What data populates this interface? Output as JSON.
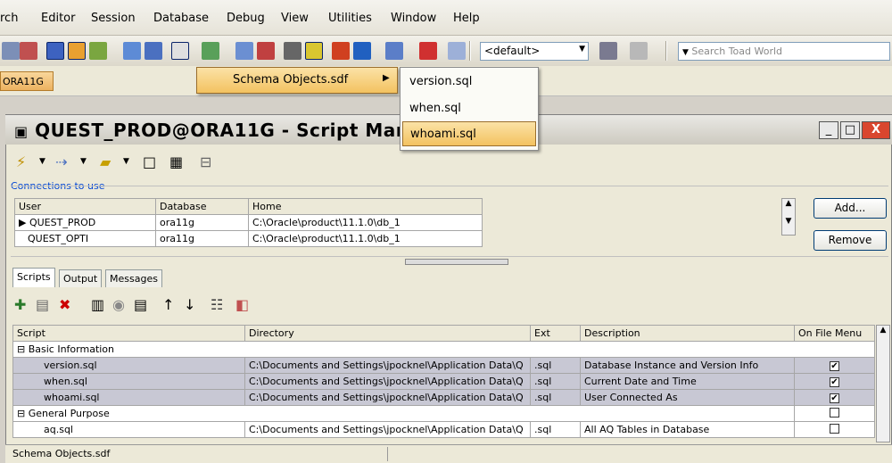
{
  "menu": [
    "rch",
    "Editor",
    "Session",
    "Database",
    "Debug",
    "View",
    "Utilities",
    "Window",
    "Help"
  ],
  "toolbar": {
    "default_value": "<default>",
    "search_placeholder": "Search Toad World"
  },
  "connection_tab": "ORA11G",
  "submenu": {
    "parent_label": "Schema Objects.sdf",
    "items": [
      "version.sql",
      "when.sql",
      "whoami.sql"
    ]
  },
  "window": {
    "title": "QUEST_PROD@ORA11G - Script Manage",
    "min": "_",
    "max": "□",
    "close": "X"
  },
  "connections": {
    "group_label": "Connections to use",
    "headers": [
      "User",
      "Database",
      "Home"
    ],
    "rows": [
      [
        "QUEST_PROD",
        "ora11g",
        "C:\\Oracle\\product\\11.1.0\\db_1"
      ],
      [
        "QUEST_OPTI",
        "ora11g",
        "C:\\Oracle\\product\\11.1.0\\db_1"
      ]
    ],
    "add_label": "Add...",
    "remove_label": "Remove"
  },
  "tabs": [
    "Scripts",
    "Output",
    "Messages"
  ],
  "scripts": {
    "headers": [
      "Script",
      "Directory",
      "Ext",
      "Description",
      "On File Menu"
    ],
    "groups": [
      {
        "name": "Basic Information",
        "rows": [
          {
            "script": "version.sql",
            "dir": "C:\\Documents and Settings\\jpocknel\\Application Data\\Q",
            "ext": ".sql",
            "desc": "Database Instance and Version Info",
            "checked": "✔"
          },
          {
            "script": "when.sql",
            "dir": "C:\\Documents and Settings\\jpocknel\\Application Data\\Q",
            "ext": ".sql",
            "desc": "Current Date and Time",
            "checked": "✔"
          },
          {
            "script": "whoami.sql",
            "dir": "C:\\Documents and Settings\\jpocknel\\Application Data\\Q",
            "ext": ".sql",
            "desc": "User Connected As",
            "checked": "✔"
          }
        ]
      },
      {
        "name": "General Purpose",
        "rows": [
          {
            "script": "aq.sql",
            "dir": "C:\\Documents and Settings\\jpocknel\\Application Data\\Q",
            "ext": ".sql",
            "desc": "All AQ Tables in Database",
            "checked": ""
          }
        ]
      }
    ]
  },
  "status": "Schema Objects.sdf"
}
